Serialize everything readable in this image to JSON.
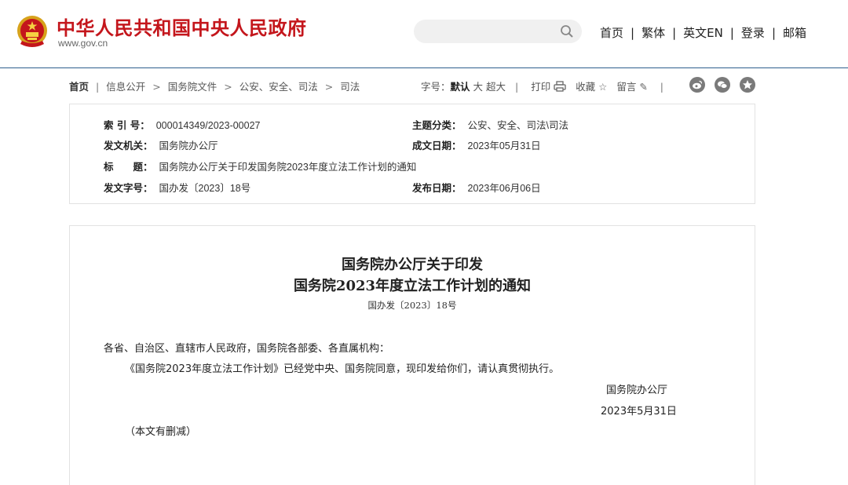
{
  "header": {
    "site_title": "中华人民共和国中央人民政府",
    "site_url": "www.gov.cn",
    "emblem_icon": "national-emblem-icon",
    "search": {
      "placeholder": "",
      "icon": "search-icon"
    },
    "nav": [
      "首页",
      "繁体",
      "英文EN",
      "登录",
      "邮箱"
    ],
    "colors": {
      "title_red": "#c4161c",
      "divider_blue": "#2e5f8d"
    }
  },
  "breadcrumb": [
    "首页",
    "信息公开",
    "国务院文件",
    "公安、安全、司法",
    "司法"
  ],
  "tools": {
    "font_size_label": "字号：",
    "font_default": "默认",
    "font_large": "大",
    "font_xlarge": "超大",
    "print": "打印",
    "favorite": "收藏",
    "comment": "留言"
  },
  "social": [
    "weibo-icon",
    "wechat-icon",
    "star-icon"
  ],
  "meta": {
    "index_label": "索 引 号：",
    "index_value": "000014349/2023-00027",
    "category_label": "主题分类：",
    "category_value": "公安、安全、司法\\司法",
    "issuer_label": "发文机关：",
    "issuer_value": "国务院办公厅",
    "date_label": "成文日期：",
    "date_value": "2023年05月31日",
    "title_label": "标　　题：",
    "title_value": "国务院办公厅关于印发国务院2023年度立法工作计划的通知",
    "docno_label": "发文字号：",
    "docno_value": "国办发〔2023〕18号",
    "publish_label": "发布日期：",
    "publish_value": "2023年06月06日"
  },
  "article": {
    "title_line1": "国务院办公厅关于印发",
    "title_line2": "国务院2023年度立法工作计划的通知",
    "doc_number": "国办发〔2023〕18号",
    "salutation": "各省、自治区、直辖市人民政府，国务院各部委、各直属机构：",
    "body": "《国务院2023年度立法工作计划》已经党中央、国务院同意，现印发给你们，请认真贯彻执行。",
    "signature": "国务院办公厅",
    "sign_date": "2023年5月31日",
    "note": "（本文有删减）"
  }
}
